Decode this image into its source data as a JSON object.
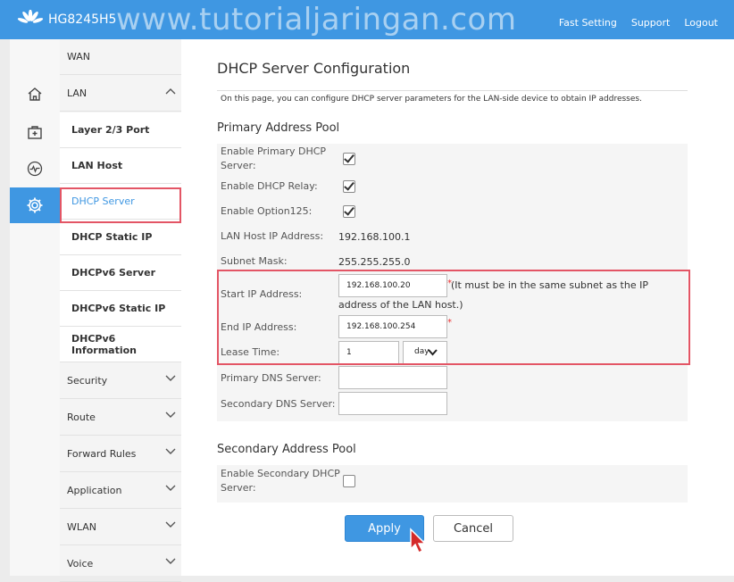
{
  "header": {
    "model": "HG8245H5",
    "watermark": "www.tutorialjaringan.com",
    "links": [
      "Fast Setting",
      "Support",
      "Logout"
    ]
  },
  "sidebar": {
    "icons": [
      "home-icon",
      "medical-box-icon",
      "heartbeat-icon",
      "gear-icon"
    ],
    "items": [
      {
        "label": "WAN"
      },
      {
        "label": "LAN"
      },
      {
        "label": "Layer 2/3 Port"
      },
      {
        "label": "LAN Host"
      },
      {
        "label": "DHCP Server"
      },
      {
        "label": "DHCP Static IP"
      },
      {
        "label": "DHCPv6 Server"
      },
      {
        "label": "DHCPv6 Static IP"
      },
      {
        "label": "DHCPv6 Information"
      },
      {
        "label": "Security"
      },
      {
        "label": "Route"
      },
      {
        "label": "Forward Rules"
      },
      {
        "label": "Application"
      },
      {
        "label": "WLAN"
      },
      {
        "label": "Voice"
      }
    ]
  },
  "main": {
    "title": "DHCP Server Configuration",
    "description": "On this page, you can configure DHCP server parameters for the LAN-side device to obtain IP addresses.",
    "primary": {
      "heading": "Primary Address Pool",
      "enable_primary_label": "Enable Primary DHCP Server:",
      "enable_relay_label": "Enable DHCP Relay:",
      "enable_option_label": "Enable Option125:",
      "lan_host_ip_label": "LAN Host IP Address:",
      "lan_host_ip_value": "192.168.100.1",
      "subnet_mask_label": "Subnet Mask:",
      "subnet_mask_value": "255.255.255.0",
      "start_ip_label": "Start IP Address:",
      "start_ip_value": "192.168.100.20",
      "start_ip_note": "(It must be in the same subnet as the IP address of the LAN host.)",
      "end_ip_label": "End IP Address:",
      "end_ip_value": "192.168.100.254",
      "lease_label": "Lease Time:",
      "lease_value": "1",
      "lease_unit": "day",
      "primary_dns_label": "Primary DNS Server:",
      "primary_dns_value": "",
      "secondary_dns_label": "Secondary DNS Server:",
      "secondary_dns_value": "",
      "required_mark": "*"
    },
    "secondary": {
      "heading": "Secondary Address Pool",
      "enable_secondary_label": "Enable Secondary DHCP Server:"
    },
    "buttons": {
      "apply": "Apply",
      "cancel": "Cancel"
    }
  }
}
